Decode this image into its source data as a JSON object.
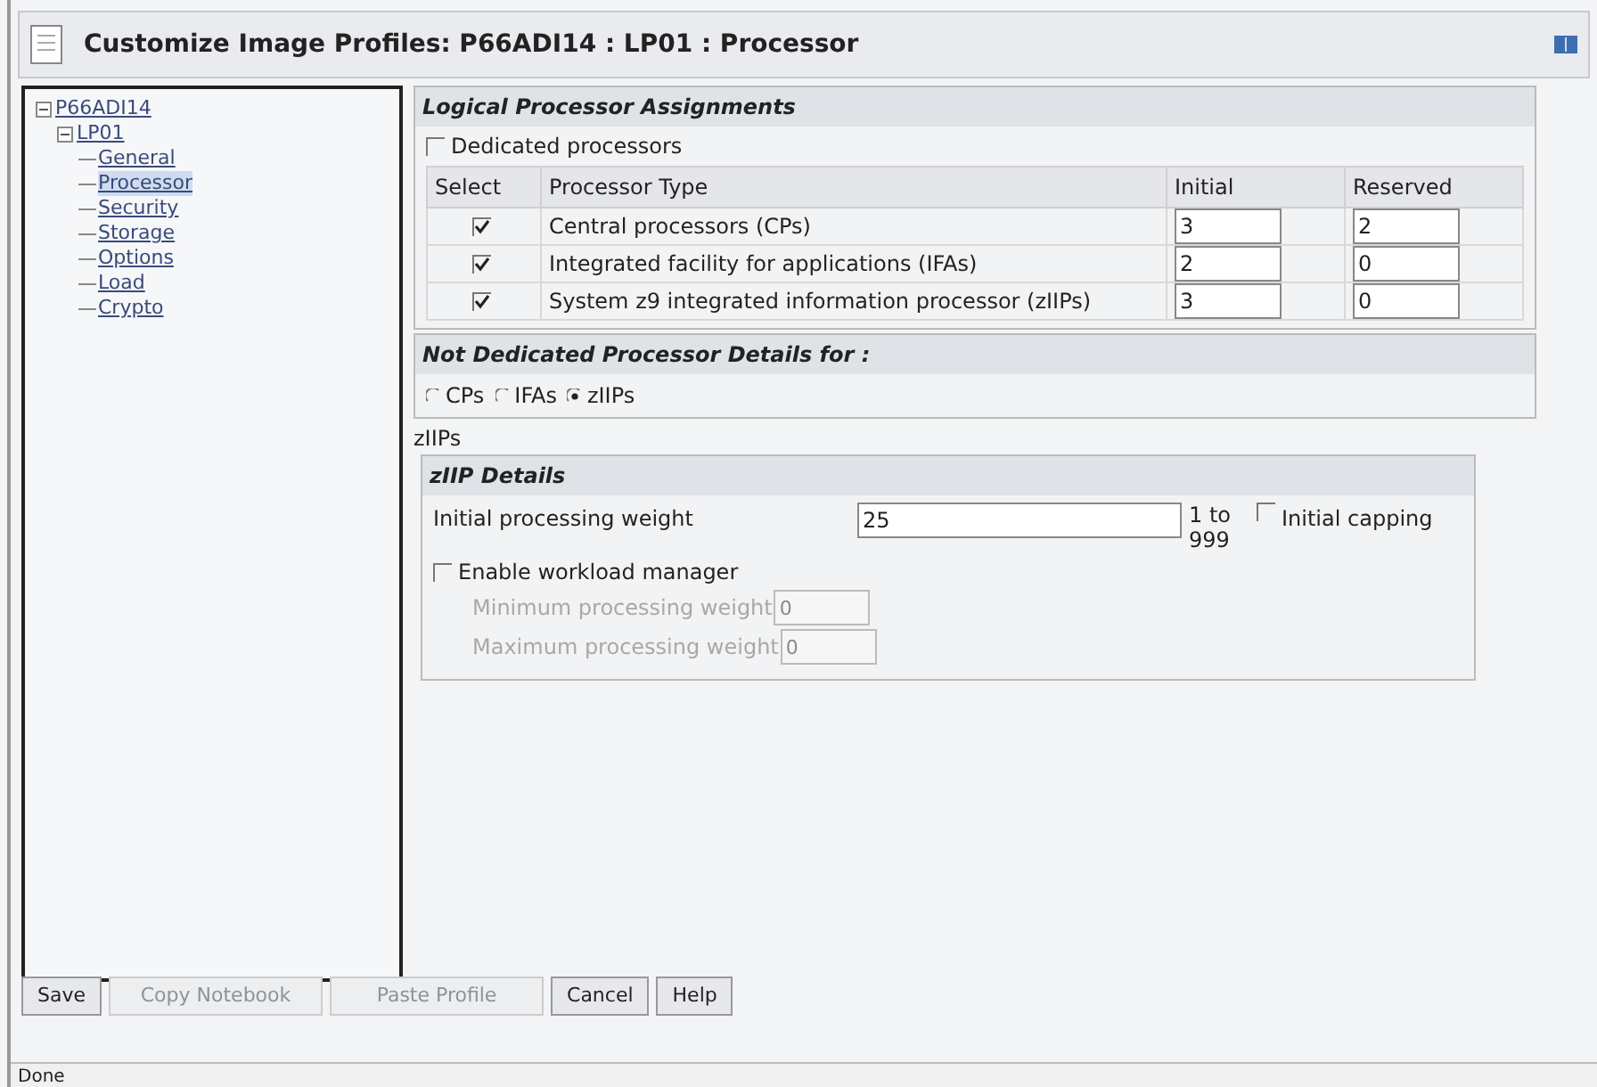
{
  "window": {
    "title": "Customize Image Profiles: P66ADI14 : LP01 : Processor"
  },
  "tree": {
    "label": "P66ADI14",
    "expanded": true,
    "children": [
      {
        "label": "LP01",
        "expanded": true,
        "children": [
          {
            "label": "General",
            "selected": false
          },
          {
            "label": "Processor",
            "selected": true
          },
          {
            "label": "Security",
            "selected": false
          },
          {
            "label": "Storage",
            "selected": false
          },
          {
            "label": "Options",
            "selected": false
          },
          {
            "label": "Load",
            "selected": false
          },
          {
            "label": "Crypto",
            "selected": false
          }
        ]
      }
    ]
  },
  "assignments": {
    "title": "Logical Processor Assignments",
    "dedicated": {
      "label": "Dedicated processors",
      "checked": false
    },
    "columns": [
      "Select",
      "Processor Type",
      "Initial",
      "Reserved"
    ],
    "rows": [
      {
        "checked": true,
        "type": "Central processors (CPs)",
        "initial": "3",
        "reserved": "2"
      },
      {
        "checked": true,
        "type": "Integrated facility for applications (IFAs)",
        "initial": "2",
        "reserved": "0"
      },
      {
        "checked": true,
        "type": "System z9 integrated information processor (zIIPs)",
        "initial": "3",
        "reserved": "0"
      }
    ]
  },
  "not_dedicated": {
    "title": "Not Dedicated Processor Details for :",
    "options": [
      {
        "label": "CPs",
        "selected": false
      },
      {
        "label": "IFAs",
        "selected": false
      },
      {
        "label": "zIIPs",
        "selected": true
      }
    ]
  },
  "current": "zIIPs",
  "details": {
    "title": "zIIP Details",
    "weight_label": "Initial processing weight",
    "weight_value": "25",
    "range": "1 to 999",
    "capping": {
      "label": "Initial capping",
      "checked": false
    },
    "wlm": {
      "label": "Enable workload manager",
      "checked": false
    },
    "limits": [
      {
        "label": "Minimum processing weight",
        "value": "0",
        "disabled": true
      },
      {
        "label": "Maximum processing weight",
        "value": "0",
        "disabled": true
      }
    ]
  },
  "buttons": [
    {
      "label": "Save",
      "disabled": false
    },
    {
      "label": "Copy Notebook",
      "disabled": true
    },
    {
      "label": "Paste Profile",
      "disabled": true
    },
    {
      "label": "Cancel",
      "disabled": false
    },
    {
      "label": "Help",
      "disabled": false
    }
  ],
  "status_bar": "Done"
}
